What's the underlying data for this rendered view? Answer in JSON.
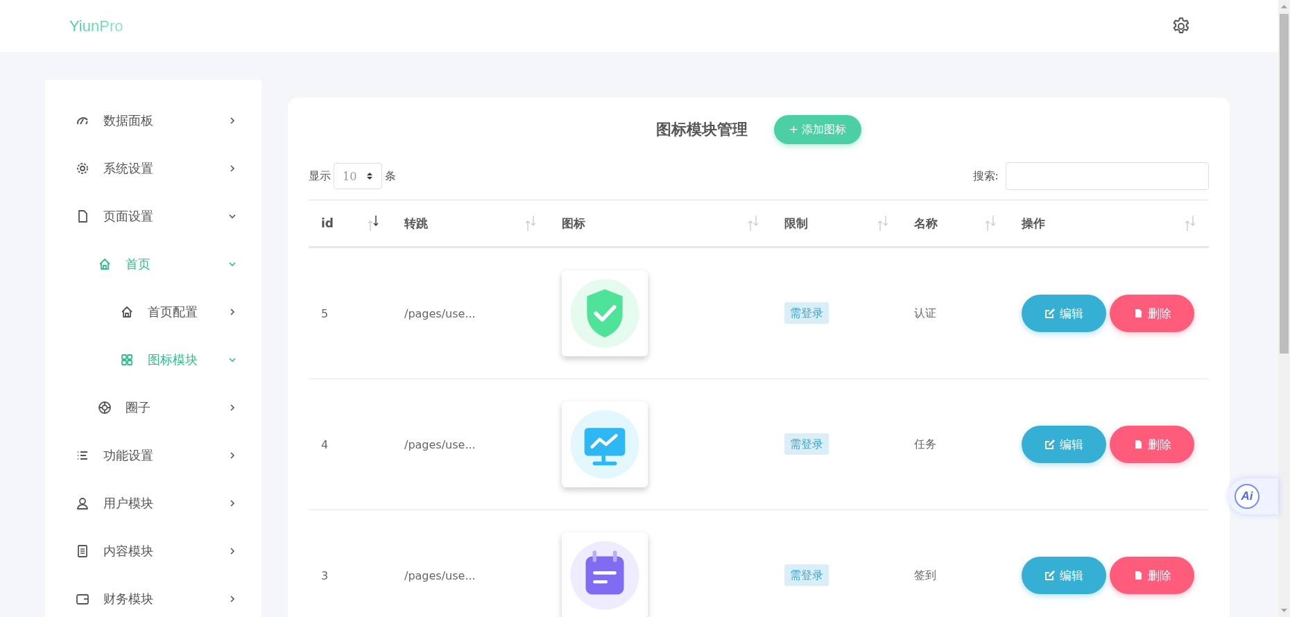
{
  "header": {
    "logo": "YiunPro"
  },
  "sidebar": {
    "items": [
      {
        "label": "数据面板",
        "expanded": false,
        "selected": false
      },
      {
        "label": "系统设置",
        "expanded": false,
        "selected": false
      },
      {
        "label": "页面设置",
        "expanded": true,
        "selected": false,
        "children": [
          {
            "label": "首页",
            "expanded": true,
            "selected": true,
            "children": [
              {
                "label": "首页配置",
                "expanded": false,
                "selected": false
              },
              {
                "label": "图标模块",
                "expanded": true,
                "selected": true
              }
            ]
          },
          {
            "label": "圈子",
            "expanded": false,
            "selected": false
          }
        ]
      },
      {
        "label": "功能设置",
        "expanded": false,
        "selected": false
      },
      {
        "label": "用户模块",
        "expanded": false,
        "selected": false
      },
      {
        "label": "内容模块",
        "expanded": false,
        "selected": false
      },
      {
        "label": "财务模块",
        "expanded": false,
        "selected": false
      }
    ]
  },
  "panel": {
    "title": "图标模块管理",
    "add_button": "添加图标",
    "add_icon": "+",
    "length": {
      "prefix": "显示",
      "value": "10",
      "suffix": "条"
    },
    "search": {
      "label": "搜索:"
    },
    "table": {
      "columns": [
        {
          "label": "id",
          "sorted": true
        },
        {
          "label": "转跳",
          "sorted": false
        },
        {
          "label": "图标",
          "sorted": false
        },
        {
          "label": "限制",
          "sorted": false
        },
        {
          "label": "名称",
          "sorted": false
        },
        {
          "label": "操作",
          "sorted": false
        }
      ],
      "rows": [
        {
          "id": "5",
          "link": "/pages/use...",
          "restriction": "需登录",
          "name": "认证",
          "edit": "编辑",
          "delete": "删除"
        },
        {
          "id": "4",
          "link": "/pages/use...",
          "restriction": "需登录",
          "name": "任务",
          "edit": "编辑",
          "delete": "删除"
        },
        {
          "id": "3",
          "link": "/pages/use...",
          "restriction": "需登录",
          "name": "签到",
          "edit": "编辑",
          "delete": "删除"
        }
      ]
    }
  },
  "ai_button": {
    "label": "Ai"
  }
}
